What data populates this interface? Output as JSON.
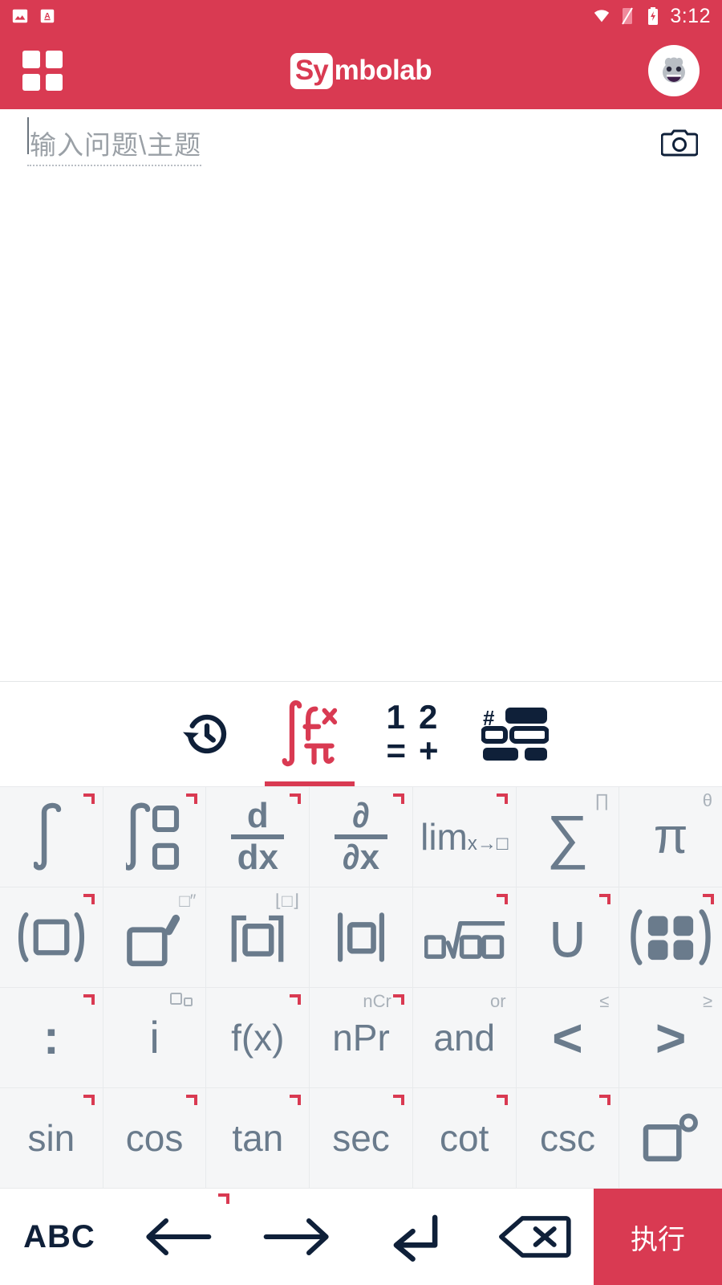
{
  "theme": {
    "brand": "#d93a52",
    "key_text": "#6a7b8c",
    "dark": "#0f2039",
    "key_bg": "#f5f6f7"
  },
  "statusbar": {
    "time": "3:12",
    "left_icons": [
      {
        "name": "image-icon",
        "glyph": "image"
      },
      {
        "name": "font-icon",
        "glyph": "A"
      }
    ],
    "right_icons": [
      {
        "name": "wifi-icon"
      },
      {
        "name": "signal-off-icon"
      },
      {
        "name": "battery-charging-icon"
      }
    ]
  },
  "appbar": {
    "menu_icon": "grid-menu-icon",
    "logo_mark": "Sy",
    "logo_text": "mbolab",
    "avatar_icon": "user-avatar-icon"
  },
  "search": {
    "placeholder": "输入问题\\主题",
    "value": "",
    "camera_icon": "camera-icon"
  },
  "tabs": [
    {
      "id": "history",
      "icon": "history-clock-icon",
      "label": "历史",
      "active": false
    },
    {
      "id": "math",
      "icon": "integral-fx-pi-icon",
      "label": "数学符号",
      "active": true
    },
    {
      "id": "numbers",
      "icon": "numbers-icon",
      "n1": "1",
      "n2": "2",
      "n3": "=",
      "n4": "+",
      "active": false
    },
    {
      "id": "layout",
      "icon": "keyboard-layout-icon",
      "label": "布局",
      "active": false
    }
  ],
  "keyboard": {
    "rows": [
      [
        {
          "label": "∫",
          "name": "integral-key",
          "mark": true
        },
        {
          "label": "∫ᵇₐ",
          "name": "definite-integral-key",
          "mark": true,
          "type": "defint"
        },
        {
          "label": "d/dx",
          "name": "derivative-key",
          "mark": true,
          "type": "frac",
          "num": "d",
          "den": "dx"
        },
        {
          "label": "∂/∂x",
          "name": "partial-derivative-key",
          "mark": true,
          "type": "frac",
          "num": "∂",
          "den": "∂x"
        },
        {
          "label": "lim",
          "sub": "x→□",
          "name": "limit-key",
          "mark": true,
          "type": "lim"
        },
        {
          "label": "∑",
          "name": "sum-key",
          "hint": "∏"
        },
        {
          "label": "π",
          "name": "pi-key",
          "hint": "θ"
        }
      ],
      [
        {
          "label": "(□)",
          "name": "parentheses-key",
          "mark": true
        },
        {
          "label": "□′",
          "name": "prime-key",
          "hint": "□″",
          "type": "prime"
        },
        {
          "label": "⌈□⌉",
          "name": "ceiling-key",
          "hint": "⌊□⌋"
        },
        {
          "label": "|□|",
          "name": "absolute-value-key"
        },
        {
          "label": "□√□",
          "name": "nth-root-key",
          "mark": true,
          "type": "root"
        },
        {
          "label": "∪",
          "name": "union-key",
          "mark": true
        },
        {
          "label": "(□□)",
          "name": "matrix-key",
          "mark": true,
          "type": "matrix"
        }
      ],
      [
        {
          "label": ":",
          "name": "colon-key",
          "mark": true
        },
        {
          "label": "i",
          "name": "imaginary-unit-key",
          "hint": "□□",
          "type": "subscript"
        },
        {
          "label": "f(x)",
          "name": "function-key",
          "mark": true
        },
        {
          "label": "nPr",
          "name": "permutation-key",
          "hint": "nCr",
          "mark": true
        },
        {
          "label": "and",
          "name": "and-key",
          "hint": "or"
        },
        {
          "label": "<",
          "name": "less-than-key",
          "hint": "≤"
        },
        {
          "label": ">",
          "name": "greater-than-key",
          "hint": "≥"
        }
      ],
      [
        {
          "label": "sin",
          "name": "sine-key",
          "mark": true
        },
        {
          "label": "cos",
          "name": "cosine-key",
          "mark": true
        },
        {
          "label": "tan",
          "name": "tangent-key",
          "mark": true
        },
        {
          "label": "sec",
          "name": "secant-key",
          "mark": true
        },
        {
          "label": "cot",
          "name": "cotangent-key",
          "mark": true
        },
        {
          "label": "csc",
          "name": "cosecant-key",
          "mark": true
        },
        {
          "label": "□°",
          "name": "degree-key",
          "type": "degree"
        }
      ]
    ]
  },
  "actions": {
    "abc": "ABC",
    "left_arrow": "arrow-left-icon",
    "right_arrow": "arrow-right-icon",
    "enter": "enter-icon",
    "backspace": "backspace-icon",
    "go_label": "执行"
  }
}
